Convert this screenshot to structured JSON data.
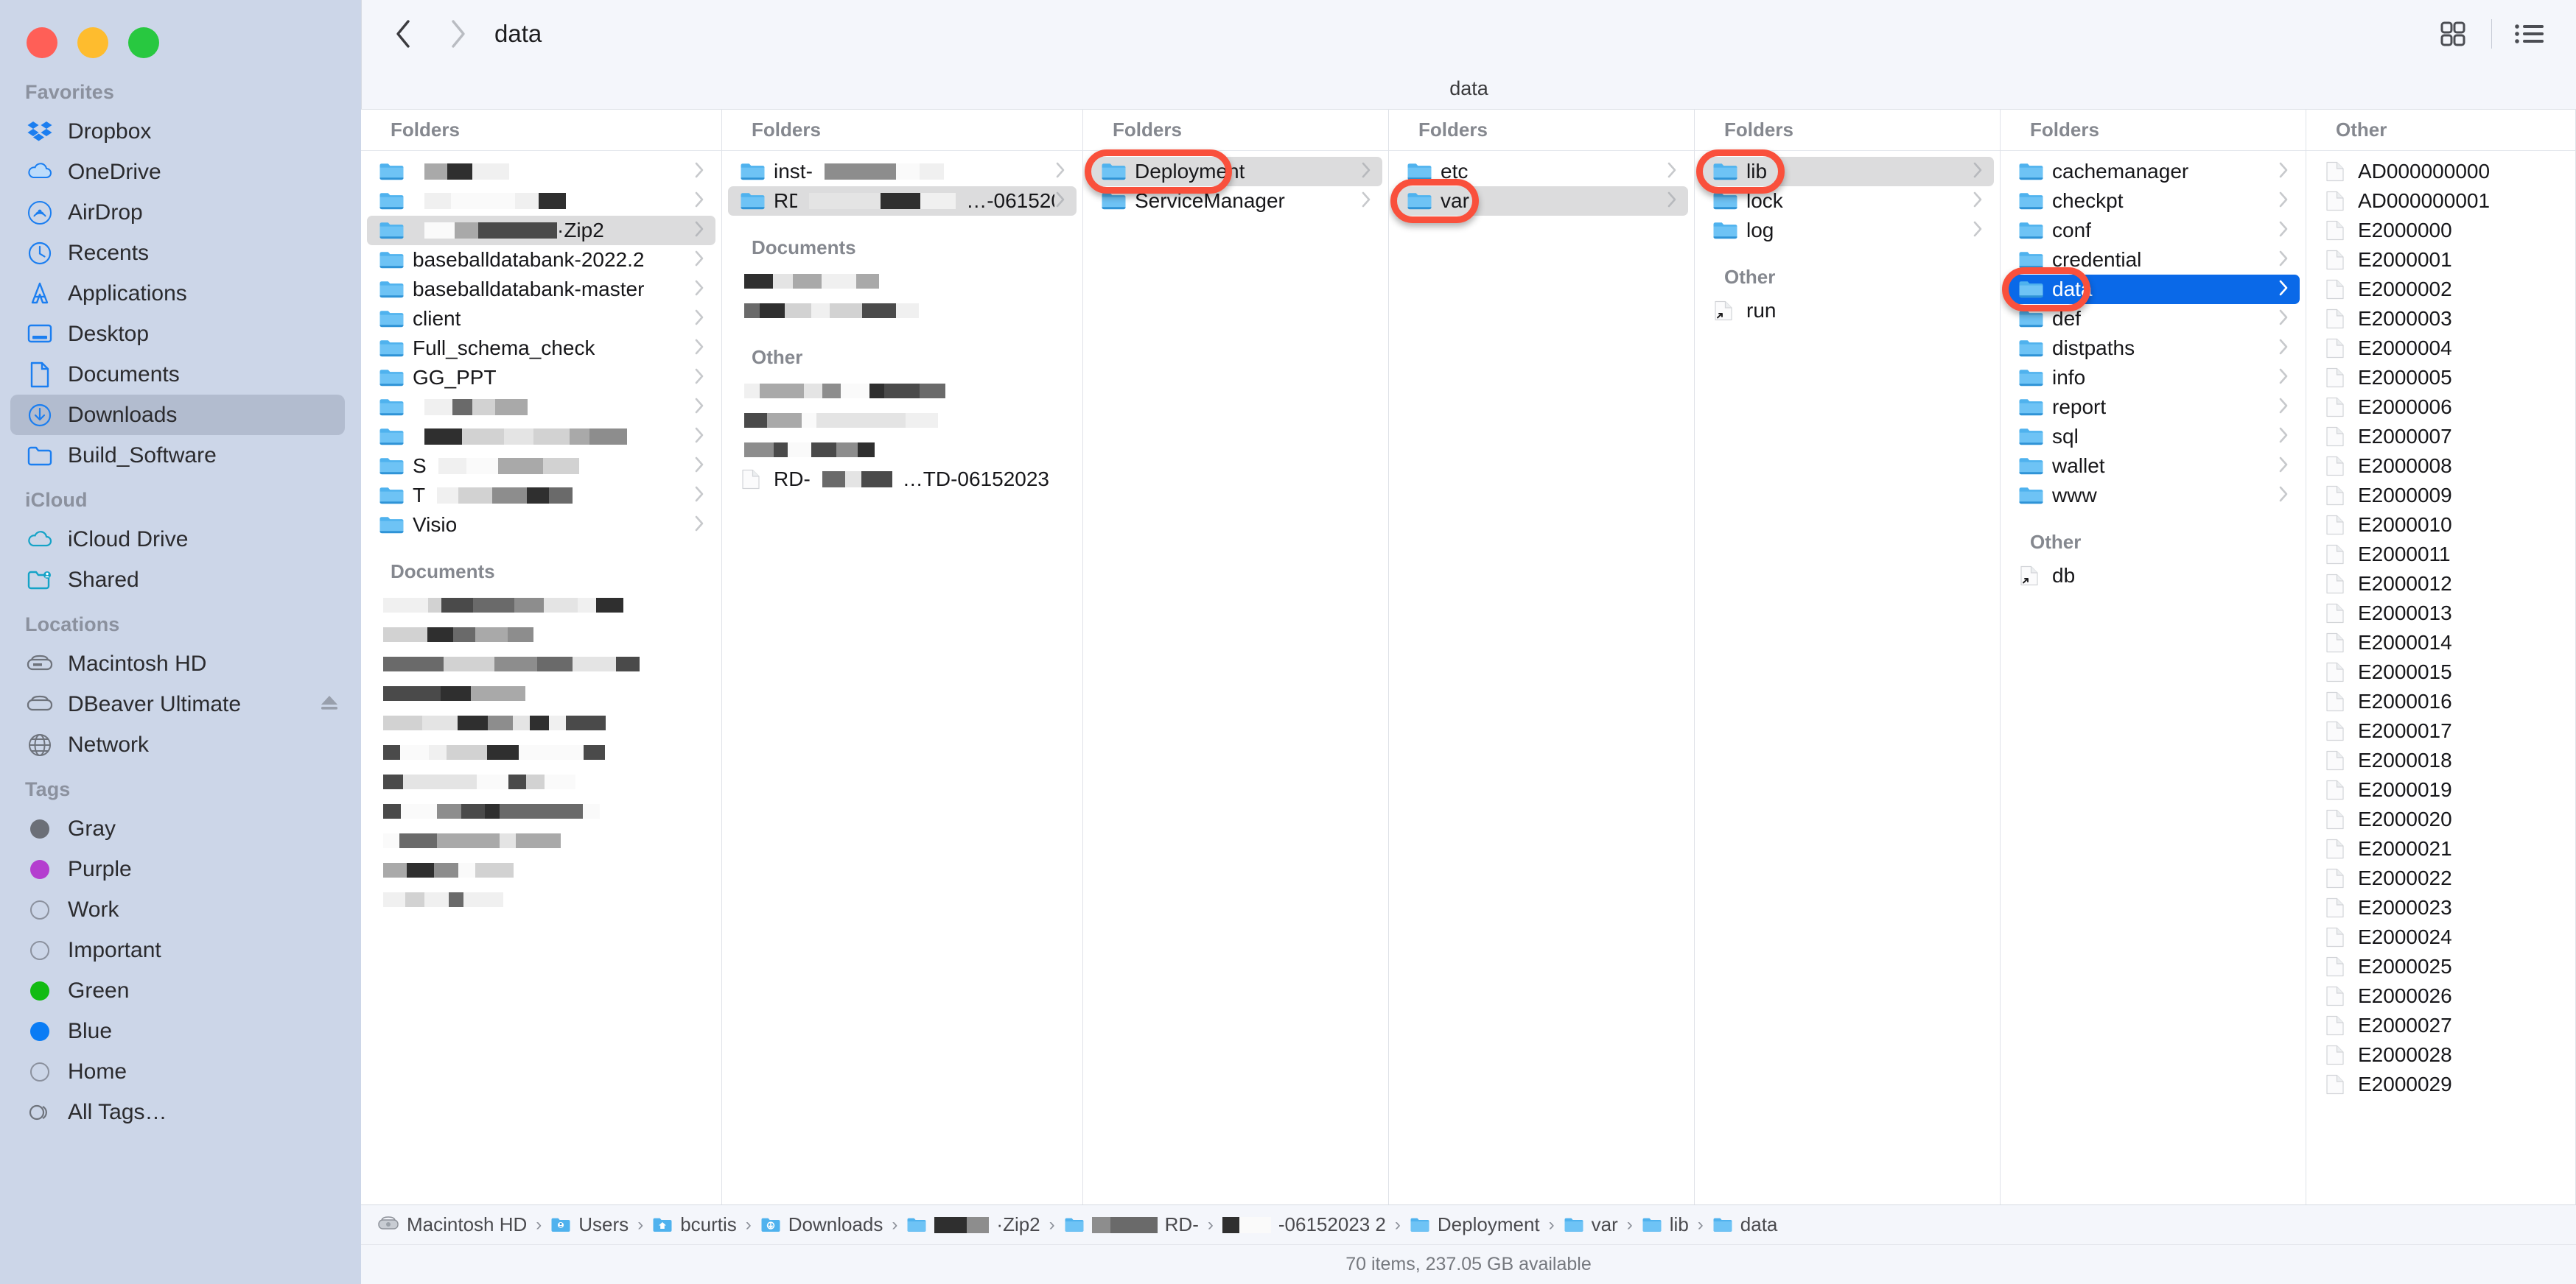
{
  "window": {
    "title": "data",
    "subbar_label": "data"
  },
  "traffic_lights": {
    "close": "close-button",
    "minimize": "minimize-button",
    "maximize": "maximize-button"
  },
  "toolbar": {
    "back_label": "‹",
    "forward_label": "›",
    "title": "data",
    "icon_view_label": "icon-view",
    "list_view_label": "list-view"
  },
  "sidebar": {
    "sections": [
      {
        "header": "Favorites",
        "items": [
          {
            "label": "Dropbox",
            "icon": "dropbox-icon",
            "selected": false
          },
          {
            "label": "OneDrive",
            "icon": "cloud-icon",
            "selected": false
          },
          {
            "label": "AirDrop",
            "icon": "airdrop-icon",
            "selected": false
          },
          {
            "label": "Recents",
            "icon": "clock-icon",
            "selected": false
          },
          {
            "label": "Applications",
            "icon": "applications-icon",
            "selected": false
          },
          {
            "label": "Desktop",
            "icon": "desktop-icon",
            "selected": false
          },
          {
            "label": "Documents",
            "icon": "document-icon",
            "selected": false
          },
          {
            "label": "Downloads",
            "icon": "download-icon",
            "selected": true
          },
          {
            "label": "Build_Software",
            "icon": "folder-icon",
            "selected": false
          }
        ]
      },
      {
        "header": "iCloud",
        "items": [
          {
            "label": "iCloud Drive",
            "icon": "icloud-icon",
            "selected": false
          },
          {
            "label": "Shared",
            "icon": "shared-folder-icon",
            "selected": false
          }
        ]
      },
      {
        "header": "Locations",
        "items": [
          {
            "label": "Macintosh HD",
            "icon": "harddisk-icon",
            "selected": false
          },
          {
            "label": "DBeaver Ultimate",
            "icon": "disk-icon",
            "selected": false,
            "eject": true
          },
          {
            "label": "Network",
            "icon": "globe-icon",
            "selected": false
          }
        ]
      },
      {
        "header": "Tags",
        "items": [
          {
            "label": "Gray",
            "icon": "tag-dot-icon",
            "color": "#6b6f77"
          },
          {
            "label": "Purple",
            "icon": "tag-dot-icon",
            "color": "#b43ecf"
          },
          {
            "label": "Work",
            "icon": "tag-dot-icon",
            "color": ""
          },
          {
            "label": "Important",
            "icon": "tag-dot-icon",
            "color": ""
          },
          {
            "label": "Green",
            "icon": "tag-dot-icon",
            "color": "#12bb12"
          },
          {
            "label": "Blue",
            "icon": "tag-dot-icon",
            "color": "#0a7cf5"
          },
          {
            "label": "Home",
            "icon": "tag-dot-icon",
            "color": ""
          },
          {
            "label": "All Tags…",
            "icon": "all-tags-icon",
            "color": ""
          }
        ]
      }
    ]
  },
  "columns": [
    {
      "header": "Folders",
      "items": [
        {
          "name": "",
          "type": "folder",
          "redacted": true,
          "selected": false,
          "chevron": true
        },
        {
          "name": "",
          "type": "folder",
          "redacted": true,
          "selected": false,
          "chevron": true
        },
        {
          "name": "·Zip2",
          "type": "folder",
          "redacted_prefix": true,
          "selected": true,
          "chevron": true
        },
        {
          "name": "baseballdatabank-2022.2",
          "type": "folder",
          "selected": false,
          "chevron": true
        },
        {
          "name": "baseballdatabank-master",
          "type": "folder",
          "selected": false,
          "chevron": true
        },
        {
          "name": "client",
          "type": "folder",
          "selected": false,
          "chevron": true
        },
        {
          "name": "Full_schema_check",
          "type": "folder",
          "selected": false,
          "chevron": true
        },
        {
          "name": "GG_PPT",
          "type": "folder",
          "selected": false,
          "chevron": true
        },
        {
          "name": "",
          "type": "folder",
          "redacted": true,
          "selected": false,
          "chevron": true
        },
        {
          "name": "",
          "type": "folder",
          "redacted": true,
          "selected": false,
          "chevron": true
        },
        {
          "name": "S",
          "type": "folder",
          "redacted": true,
          "selected": false,
          "chevron": true
        },
        {
          "name": "T",
          "type": "folder",
          "redacted": true,
          "selected": false,
          "chevron": true
        },
        {
          "name": "Visio",
          "type": "folder",
          "selected": false,
          "chevron": true
        }
      ],
      "groups": [
        {
          "header": "Documents",
          "redacted_rows": 11
        }
      ]
    },
    {
      "header": "Folders",
      "items": [
        {
          "name": "inst-",
          "type": "folder",
          "redacted": true,
          "selected": false,
          "chevron": true
        },
        {
          "name": "RD-",
          "suffix": "…-06152023 2",
          "type": "folder",
          "redacted": true,
          "selected": true,
          "chevron": true
        }
      ],
      "groups": [
        {
          "header": "Documents",
          "redacted_rows": 2
        },
        {
          "header": "Other",
          "redacted_rows": 3,
          "last_row": {
            "name": "RD-",
            "suffix": "…TD-06152023",
            "type": "file",
            "redacted": true
          }
        }
      ]
    },
    {
      "header": "Folders",
      "items": [
        {
          "name": "Deployment",
          "type": "folder",
          "selected": true,
          "chevron": true,
          "annotated": true
        },
        {
          "name": "ServiceManager",
          "type": "folder",
          "selected": false,
          "chevron": true
        }
      ]
    },
    {
      "header": "Folders",
      "items": [
        {
          "name": "etc",
          "type": "folder",
          "selected": false,
          "chevron": true
        },
        {
          "name": "var",
          "type": "folder",
          "selected": true,
          "chevron": true,
          "annotated": true
        }
      ]
    },
    {
      "header": "Folders",
      "items": [
        {
          "name": "lib",
          "type": "folder",
          "selected": true,
          "chevron": true,
          "annotated": true
        },
        {
          "name": "lock",
          "type": "folder",
          "selected": false,
          "chevron": true
        },
        {
          "name": "log",
          "type": "folder",
          "selected": false,
          "chevron": true
        }
      ],
      "groups": [
        {
          "header": "Other",
          "items": [
            {
              "name": "run",
              "type": "alias"
            }
          ]
        }
      ]
    },
    {
      "header": "Folders",
      "items": [
        {
          "name": "cachemanager",
          "type": "folder",
          "selected": false,
          "chevron": true
        },
        {
          "name": "checkpt",
          "type": "folder",
          "selected": false,
          "chevron": true
        },
        {
          "name": "conf",
          "type": "folder",
          "selected": false,
          "chevron": true
        },
        {
          "name": "credential",
          "type": "folder",
          "selected": false,
          "chevron": true
        },
        {
          "name": "data",
          "type": "folder",
          "selected": true,
          "selection_style": "blue",
          "chevron": true,
          "annotated": true
        },
        {
          "name": "def",
          "type": "folder",
          "selected": false,
          "chevron": true
        },
        {
          "name": "distpaths",
          "type": "folder",
          "selected": false,
          "chevron": true
        },
        {
          "name": "info",
          "type": "folder",
          "selected": false,
          "chevron": true
        },
        {
          "name": "report",
          "type": "folder",
          "selected": false,
          "chevron": true
        },
        {
          "name": "sql",
          "type": "folder",
          "selected": false,
          "chevron": true
        },
        {
          "name": "wallet",
          "type": "folder",
          "selected": false,
          "chevron": true
        },
        {
          "name": "www",
          "type": "folder",
          "selected": false,
          "chevron": true
        }
      ],
      "groups": [
        {
          "header": "Other",
          "items": [
            {
              "name": "db",
              "type": "alias"
            }
          ]
        }
      ]
    },
    {
      "header": "Other",
      "items": [
        {
          "name": "AD000000000",
          "type": "file"
        },
        {
          "name": "AD000000001",
          "type": "file"
        },
        {
          "name": "E2000000",
          "type": "file"
        },
        {
          "name": "E2000001",
          "type": "file"
        },
        {
          "name": "E2000002",
          "type": "file"
        },
        {
          "name": "E2000003",
          "type": "file"
        },
        {
          "name": "E2000004",
          "type": "file"
        },
        {
          "name": "E2000005",
          "type": "file"
        },
        {
          "name": "E2000006",
          "type": "file"
        },
        {
          "name": "E2000007",
          "type": "file"
        },
        {
          "name": "E2000008",
          "type": "file"
        },
        {
          "name": "E2000009",
          "type": "file"
        },
        {
          "name": "E2000010",
          "type": "file"
        },
        {
          "name": "E2000011",
          "type": "file"
        },
        {
          "name": "E2000012",
          "type": "file"
        },
        {
          "name": "E2000013",
          "type": "file"
        },
        {
          "name": "E2000014",
          "type": "file"
        },
        {
          "name": "E2000015",
          "type": "file"
        },
        {
          "name": "E2000016",
          "type": "file"
        },
        {
          "name": "E2000017",
          "type": "file"
        },
        {
          "name": "E2000018",
          "type": "file"
        },
        {
          "name": "E2000019",
          "type": "file"
        },
        {
          "name": "E2000020",
          "type": "file"
        },
        {
          "name": "E2000021",
          "type": "file"
        },
        {
          "name": "E2000022",
          "type": "file"
        },
        {
          "name": "E2000023",
          "type": "file"
        },
        {
          "name": "E2000024",
          "type": "file"
        },
        {
          "name": "E2000025",
          "type": "file"
        },
        {
          "name": "E2000026",
          "type": "file"
        },
        {
          "name": "E2000027",
          "type": "file"
        },
        {
          "name": "E2000028",
          "type": "file"
        },
        {
          "name": "E2000029",
          "type": "file"
        }
      ]
    }
  ],
  "pathbar": {
    "items": [
      {
        "label": "Macintosh HD",
        "icon": "harddisk-icon"
      },
      {
        "label": "Users",
        "icon": "users-folder-icon"
      },
      {
        "label": "bcurtis",
        "icon": "home-folder-icon"
      },
      {
        "label": "Downloads",
        "icon": "downloads-folder-icon"
      },
      {
        "label": "·Zip2",
        "icon": "folder-icon",
        "redacted": true
      },
      {
        "label": "RD-",
        "icon": "folder-icon",
        "redacted": true
      },
      {
        "label": "-06152023 2",
        "icon": "",
        "redacted": true
      },
      {
        "label": "Deployment",
        "icon": "folder-icon"
      },
      {
        "label": "var",
        "icon": "folder-icon"
      },
      {
        "label": "lib",
        "icon": "folder-icon"
      },
      {
        "label": "data",
        "icon": "folder-icon"
      }
    ],
    "separator": "›"
  },
  "statusbar": {
    "text": "70 items, 237.05 GB available"
  },
  "colors": {
    "sidebar_bg": "#ccd6e8",
    "toolbar_bg": "#f4f6fb",
    "selection_blue": "#0a69e8",
    "selection_gray": "#dcdcdd",
    "annotation_red": "#f9503c",
    "folder_blue": "#54b4f0"
  }
}
